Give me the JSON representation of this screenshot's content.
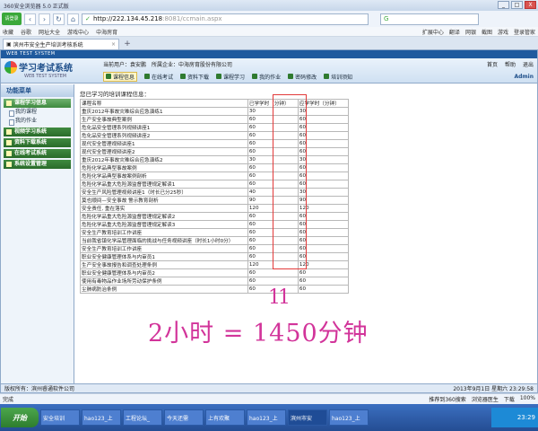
{
  "browser": {
    "title": "360安全浏览器 5.0 正式版",
    "badge": "请登录",
    "url_host": "http://222.134.45.218",
    "url_path": ":8081/ccmain.aspx",
    "search_placeholder": "",
    "win_min": "_",
    "win_max": "□",
    "win_close": "X"
  },
  "favbar": {
    "items": [
      "收藏",
      "谷歌",
      "网址大全",
      "游戏中心",
      "中海房育"
    ],
    "right_items": [
      "扩展中心",
      "翻译",
      "网银",
      "截图",
      "游戏",
      "登录管家"
    ]
  },
  "tab": {
    "label": "滨州市安全生产培训考核系统",
    "close": "×",
    "plus": "+"
  },
  "app": {
    "brand": "WEB TEST SYSTEM",
    "logo_title": "学习考试系统",
    "logo_sub": "WEB TEST SYSTEM",
    "current_user": "当前用户：袁安鹏",
    "enterprise": "所属企业：中海房育股份有限公司",
    "header_links": [
      "首页",
      "帮助",
      "退出"
    ],
    "menu": [
      "课程信息",
      "在线考试",
      "资料下载",
      "课程学习",
      "我的作业",
      "密码修改",
      "培训须知"
    ],
    "admin": "Admin"
  },
  "sidebar": {
    "head": "功能菜单",
    "sections": [
      {
        "label": "课程学习信息",
        "items": [
          "我的课程",
          "我的作业"
        ]
      },
      {
        "label": "视频学习系统",
        "items": []
      },
      {
        "label": "资料下载系统",
        "items": []
      },
      {
        "label": "在线考试系统",
        "items": []
      },
      {
        "label": "系统设置管理",
        "items": []
      }
    ]
  },
  "content": {
    "title": "您已学习的培训课程信息：",
    "headers": [
      "课程名称",
      "已学学时（分钟）",
      "应学学时（分钟）"
    ],
    "rows": [
      [
        "重庆2012年事故灾难综合应急演练1",
        "30",
        "30"
      ],
      [
        "生产安全事故典型案例",
        "60",
        "60"
      ],
      [
        "危化品安全管理系列视频讲座1",
        "60",
        "60"
      ],
      [
        "危化品安全管理系列视频讲座2",
        "60",
        "60"
      ],
      [
        "现代安全管理视频讲座1",
        "60",
        "60"
      ],
      [
        "现代安全管理视频讲座2",
        "60",
        "60"
      ],
      [
        "重庆2012年事故灾难综合应急演练2",
        "30",
        "30"
      ],
      [
        "危险化学品典型事故案例",
        "60",
        "60"
      ],
      [
        "危险化学品典型事故案例剖析",
        "60",
        "60"
      ],
      [
        "危险化学品重大危险源监督管理规定解读1",
        "60",
        "60"
      ],
      [
        "安全生产风险管理视频讲座1（时长已分25秒）",
        "40",
        "30"
      ],
      [
        "莫也顺间—安全事故 警示教育剖析",
        "90",
        "90"
      ],
      [
        "安全责任, 重在落实",
        "120",
        "120"
      ],
      [
        "危险化学品重大危险源监督管理规定解读2",
        "60",
        "60"
      ],
      [
        "危险化学品重大危险源监督管理规定解读3",
        "60",
        "60"
      ],
      [
        "安全生产教育培训工作讲座",
        "60",
        "60"
      ],
      [
        "当前我省镇化学品管理面临的挑战与任务视频讲座（时长1小时0分）",
        "60",
        "60"
      ],
      [
        "安全生产教育培训工作讲座",
        "60",
        "60"
      ],
      [
        "职业安全健康管理体系与内审员1",
        "60",
        "60"
      ],
      [
        "生产安全事故报告和调查处理条例",
        "120",
        "120"
      ],
      [
        "职业安全健康管理体系与内审员2",
        "60",
        "60"
      ],
      [
        "使用有毒物品作业场所劳动保护条例",
        "60",
        "60"
      ],
      [
        "尘肺病防治条例",
        "60",
        "60"
      ]
    ],
    "handwritten_eleven": "11",
    "handwritten_note": "2小时 = 1450分钟"
  },
  "app_footer": {
    "left": "版权所有：滨州睿通软件公司",
    "right": "2013年9月1日 星期六 23:29:58"
  },
  "statusbar": {
    "left": "完成",
    "items": [
      "推荐到360搜索",
      "浏览器医生",
      "下载",
      "100%"
    ]
  },
  "taskbar": {
    "start": "开始",
    "tasks": [
      "安全培训",
      "hao123_上",
      "工程论坛_",
      "今天还需",
      "上有欢聚",
      "hao123_上",
      "滨州市安",
      "hao123_上"
    ],
    "clock": "23:29"
  }
}
